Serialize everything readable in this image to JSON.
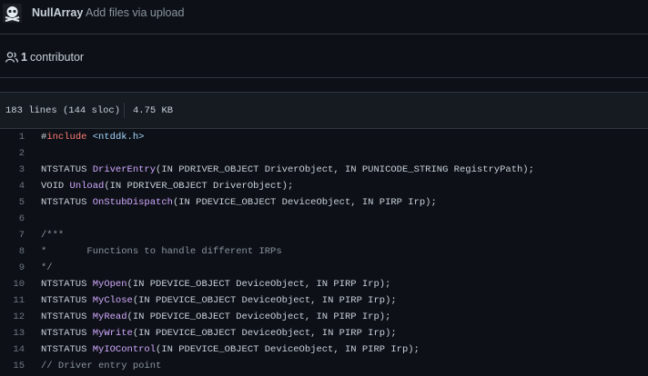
{
  "commit": {
    "author": "NullArray",
    "message": "Add files via upload",
    "avatar_icon": "skull-crossbones-icon"
  },
  "contributors": {
    "icon": "people-icon",
    "count": "1",
    "label": "contributor"
  },
  "file_info": {
    "lines": "183 lines (144 sloc)",
    "size": "4.75 KB"
  },
  "colors": {
    "background": "#0d1117",
    "keyword": "#ff7b72",
    "string": "#a5d6ff",
    "function": "#d2a8ff",
    "comment": "#8b949e"
  },
  "code_lines": [
    {
      "num": "1",
      "tokens": [
        {
          "t": "#",
          "c": ""
        },
        {
          "t": "include",
          "c": "kw"
        },
        {
          "t": " ",
          "c": ""
        },
        {
          "t": "<ntddk.h>",
          "c": "str"
        }
      ]
    },
    {
      "num": "2",
      "tokens": []
    },
    {
      "num": "3",
      "tokens": [
        {
          "t": "NTSTATUS ",
          "c": ""
        },
        {
          "t": "DriverEntry",
          "c": "fn"
        },
        {
          "t": "(IN PDRIVER_OBJECT DriverObject, IN PUNICODE_STRING RegistryPath);",
          "c": ""
        }
      ]
    },
    {
      "num": "4",
      "tokens": [
        {
          "t": "VOID ",
          "c": ""
        },
        {
          "t": "Unload",
          "c": "fn"
        },
        {
          "t": "(IN PDRIVER_OBJECT DriverObject);",
          "c": ""
        }
      ]
    },
    {
      "num": "5",
      "tokens": [
        {
          "t": "NTSTATUS ",
          "c": ""
        },
        {
          "t": "OnStubDispatch",
          "c": "fn"
        },
        {
          "t": "(IN PDEVICE_OBJECT DeviceObject, IN PIRP Irp);",
          "c": ""
        }
      ]
    },
    {
      "num": "6",
      "tokens": []
    },
    {
      "num": "7",
      "tokens": [
        {
          "t": "/***",
          "c": "cm"
        }
      ]
    },
    {
      "num": "8",
      "tokens": [
        {
          "t": "*       Functions to handle different IRPs",
          "c": "cm"
        }
      ]
    },
    {
      "num": "9",
      "tokens": [
        {
          "t": "*/",
          "c": "cm"
        }
      ]
    },
    {
      "num": "10",
      "tokens": [
        {
          "t": "NTSTATUS ",
          "c": ""
        },
        {
          "t": "MyOpen",
          "c": "fn"
        },
        {
          "t": "(IN PDEVICE_OBJECT DeviceObject, IN PIRP Irp);",
          "c": ""
        }
      ]
    },
    {
      "num": "11",
      "tokens": [
        {
          "t": "NTSTATUS ",
          "c": ""
        },
        {
          "t": "MyClose",
          "c": "fn"
        },
        {
          "t": "(IN PDEVICE_OBJECT DeviceObject, IN PIRP Irp);",
          "c": ""
        }
      ]
    },
    {
      "num": "12",
      "tokens": [
        {
          "t": "NTSTATUS ",
          "c": ""
        },
        {
          "t": "MyRead",
          "c": "fn"
        },
        {
          "t": "(IN PDEVICE_OBJECT DeviceObject, IN PIRP Irp);",
          "c": ""
        }
      ]
    },
    {
      "num": "13",
      "tokens": [
        {
          "t": "NTSTATUS ",
          "c": ""
        },
        {
          "t": "MyWrite",
          "c": "fn"
        },
        {
          "t": "(IN PDEVICE_OBJECT DeviceObject, IN PIRP Irp);",
          "c": ""
        }
      ]
    },
    {
      "num": "14",
      "tokens": [
        {
          "t": "NTSTATUS ",
          "c": ""
        },
        {
          "t": "MyIOControl",
          "c": "fn"
        },
        {
          "t": "(IN PDEVICE_OBJECT DeviceObject, IN PIRP Irp);",
          "c": ""
        }
      ]
    },
    {
      "num": "15",
      "tokens": [
        {
          "t": "// Driver entry point",
          "c": "cm"
        }
      ]
    }
  ]
}
